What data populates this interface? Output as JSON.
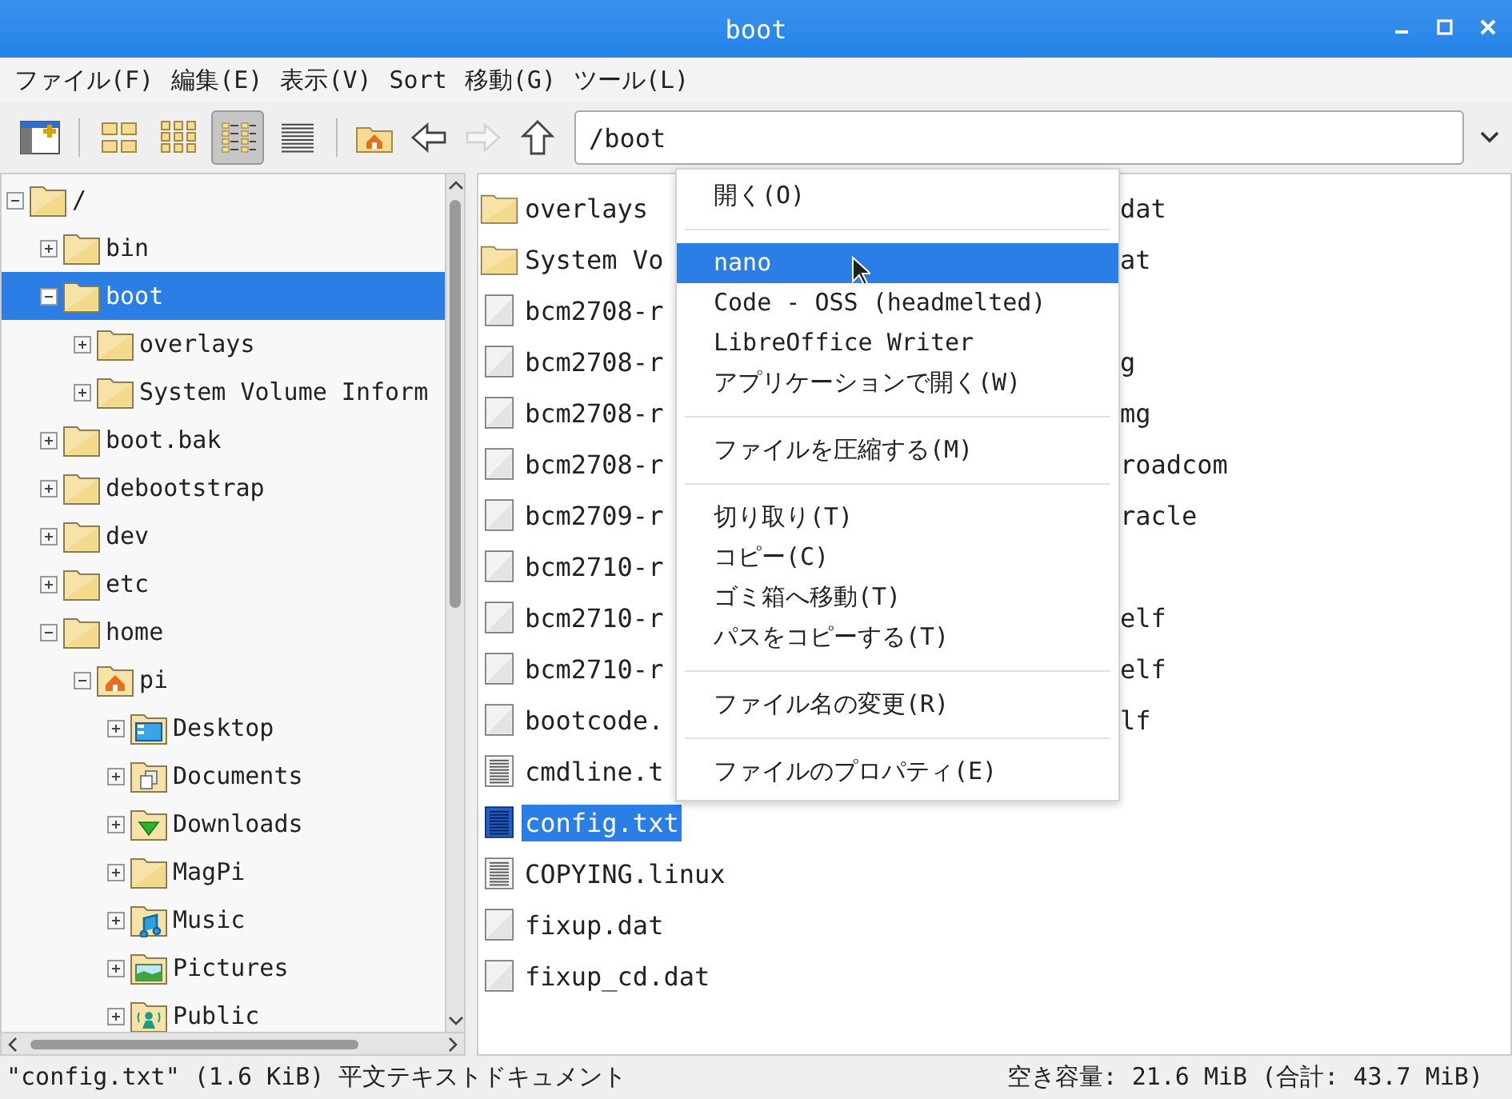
{
  "window": {
    "title": "boot"
  },
  "menu_bar": [
    "ファイル(F)",
    "編集(E)",
    "表示(V)",
    "Sort",
    "移動(G)",
    "ツール(L)"
  ],
  "toolbar": {
    "view_modes": [
      {
        "kind": "icons",
        "selected": false
      },
      {
        "kind": "thumbnails",
        "selected": false
      },
      {
        "kind": "compact",
        "selected": true
      },
      {
        "kind": "list",
        "selected": false
      }
    ],
    "nav_buttons": [
      {
        "kind": "home",
        "disabled": false
      },
      {
        "kind": "back",
        "disabled": false
      },
      {
        "kind": "forward",
        "disabled": true
      },
      {
        "kind": "up",
        "disabled": false
      }
    ],
    "path": "/boot"
  },
  "tree": [
    {
      "label": "/",
      "kind": "folder",
      "expanded": true,
      "selected": false,
      "children": [
        {
          "label": "bin",
          "kind": "folder",
          "expanded": false,
          "selected": false
        },
        {
          "label": "boot",
          "kind": "folder",
          "expanded": true,
          "selected": true,
          "children": [
            {
              "label": "overlays",
              "kind": "folder",
              "expanded": false,
              "selected": false
            },
            {
              "label": "System Volume Inform",
              "kind": "folder",
              "expanded": false,
              "selected": false
            }
          ]
        },
        {
          "label": "boot.bak",
          "kind": "folder",
          "expanded": false,
          "selected": false
        },
        {
          "label": "debootstrap",
          "kind": "folder",
          "expanded": false,
          "selected": false
        },
        {
          "label": "dev",
          "kind": "folder",
          "expanded": false,
          "selected": false
        },
        {
          "label": "etc",
          "kind": "folder",
          "expanded": false,
          "selected": false
        },
        {
          "label": "home",
          "kind": "folder",
          "expanded": true,
          "selected": false,
          "children": [
            {
              "label": "pi",
              "kind": "home",
              "expanded": true,
              "selected": false,
              "children": [
                {
                  "label": "Desktop",
                  "kind": "desktop",
                  "expanded": false,
                  "selected": false
                },
                {
                  "label": "Documents",
                  "kind": "documents",
                  "expanded": false,
                  "selected": false
                },
                {
                  "label": "Downloads",
                  "kind": "downloads",
                  "expanded": false,
                  "selected": false
                },
                {
                  "label": "MagPi",
                  "kind": "folder",
                  "expanded": false,
                  "selected": false
                },
                {
                  "label": "Music",
                  "kind": "music",
                  "expanded": false,
                  "selected": false
                },
                {
                  "label": "Pictures",
                  "kind": "pictures",
                  "expanded": false,
                  "selected": false
                },
                {
                  "label": "Public",
                  "kind": "public",
                  "expanded": false,
                  "selected": false
                }
              ]
            }
          ]
        }
      ]
    }
  ],
  "files": [
    {
      "name": "overlays",
      "kind": "folder",
      "selected": false,
      "column_2": "dat"
    },
    {
      "name": "System Vo",
      "kind": "folder",
      "selected": false,
      "column_2": "at"
    },
    {
      "name": "bcm2708-r",
      "kind": "file",
      "selected": false
    },
    {
      "name": "bcm2708-r",
      "kind": "file",
      "selected": false,
      "column_2": "g"
    },
    {
      "name": "bcm2708-r",
      "kind": "file",
      "selected": false,
      "column_2": "mg"
    },
    {
      "name": "bcm2708-r",
      "kind": "file",
      "selected": false,
      "column_2": "roadcom"
    },
    {
      "name": "bcm2709-r",
      "kind": "file",
      "selected": false,
      "column_2": "racle"
    },
    {
      "name": "bcm2710-r",
      "kind": "file",
      "selected": false
    },
    {
      "name": "bcm2710-r",
      "kind": "file",
      "selected": false,
      "column_2": "elf"
    },
    {
      "name": "bcm2710-r",
      "kind": "file",
      "selected": false,
      "column_2": "elf"
    },
    {
      "name": "bootcode.",
      "kind": "file",
      "selected": false,
      "column_2": "lf"
    },
    {
      "name": "cmdline.t",
      "kind": "text",
      "selected": false
    },
    {
      "name": "config.txt",
      "kind": "text",
      "selected": true
    },
    {
      "name": "COPYING.linux",
      "kind": "text",
      "selected": false
    },
    {
      "name": "fixup.dat",
      "kind": "file",
      "selected": false
    },
    {
      "name": "fixup_cd.dat",
      "kind": "file",
      "selected": false
    }
  ],
  "context_menu": [
    {
      "kind": "item",
      "label": "開く(O)",
      "selected": false
    },
    {
      "kind": "separator"
    },
    {
      "kind": "item",
      "label": "nano",
      "selected": true
    },
    {
      "kind": "item",
      "label": "Code - OSS (headmelted)",
      "selected": false
    },
    {
      "kind": "item",
      "label": "LibreOffice Writer",
      "selected": false
    },
    {
      "kind": "item",
      "label": "アプリケーションで開く(W)",
      "selected": false
    },
    {
      "kind": "separator"
    },
    {
      "kind": "item",
      "label": "ファイルを圧縮する(M)",
      "selected": false
    },
    {
      "kind": "separator"
    },
    {
      "kind": "item",
      "label": "切り取り(T)",
      "selected": false
    },
    {
      "kind": "item",
      "label": "コピー(C)",
      "selected": false
    },
    {
      "kind": "item",
      "label": "ゴミ箱へ移動(T)",
      "selected": false
    },
    {
      "kind": "item",
      "label": "パスをコピーする(T)",
      "selected": false
    },
    {
      "kind": "separator"
    },
    {
      "kind": "item",
      "label": "ファイル名の変更(R)",
      "selected": false
    },
    {
      "kind": "separator"
    },
    {
      "kind": "item",
      "label": "ファイルのプロパティ(E)",
      "selected": false
    }
  ],
  "status_bar": {
    "left": "\"config.txt\" (1.6 KiB) 平文テキストドキュメント",
    "right": "空き容量: 21.6 MiB (合計: 43.7 MiB)"
  }
}
